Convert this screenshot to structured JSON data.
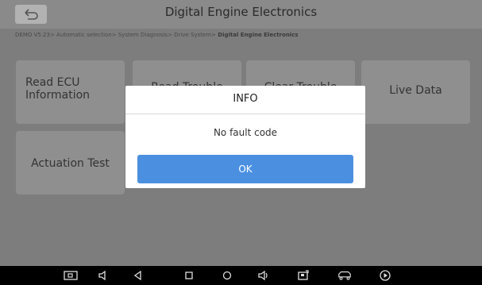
{
  "header": {
    "title": "Digital Engine Electronics"
  },
  "breadcrumb": {
    "path": "DEMO V5.23> Automatic selection> System Diagnosis> Drive System> ",
    "current": "Digital Engine Electronics"
  },
  "tiles": {
    "read_ecu_line1": "Read ECU",
    "read_ecu_line2": "Information",
    "read_trouble": "Read Trouble",
    "clear_trouble": "Clear Trouble",
    "live_data": "Live Data",
    "actuation_test": "Actuation Test"
  },
  "dialog": {
    "title": "INFO",
    "message": "No fault code",
    "ok_label": "OK"
  },
  "navbar": {
    "icons": [
      "screenshot-icon",
      "volume-down-icon",
      "back-icon",
      "home-icon",
      "circle-icon",
      "volume-up-icon",
      "vci-icon",
      "car-icon",
      "play-icon"
    ]
  }
}
